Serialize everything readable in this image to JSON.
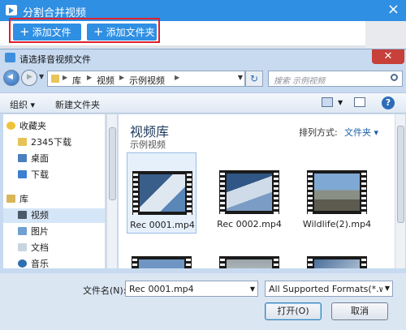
{
  "app": {
    "title": "分割合并视频",
    "close": "×",
    "add_file": "添加文件",
    "add_folder": "添加文件夹",
    "plus": "+"
  },
  "dialog": {
    "title": "请选择音视频文件",
    "close": "✕",
    "breadcrumbs": [
      "库",
      "视频",
      "示例视频"
    ],
    "search_placeholder": "搜索 示例视频",
    "organize": "组织 ▾",
    "new_folder": "新建文件夹",
    "help": "?",
    "nav": {
      "favorites": "收藏夹",
      "fav_items": [
        "2345下载",
        "桌面",
        "下载"
      ],
      "libraries": "库",
      "lib_items": [
        "视频",
        "图片",
        "文档",
        "音乐"
      ]
    },
    "library_title": "视频库",
    "library_subtitle": "示例视频",
    "arrange_label": "排列方式:",
    "arrange_value": "文件夹 ▾",
    "files": [
      "Rec 0001.mp4",
      "Rec 0002.mp4",
      "Wildlife(2).mp4"
    ],
    "filename_label": "文件名(N):",
    "filename_value": "Rec 0001.mp4",
    "filter_value": "All Supported Formats(*.wtv;",
    "open": "打开(O)",
    "cancel": "取消"
  },
  "colors": {
    "accent": "#2f8fe3",
    "highlight": "#e0202c",
    "dialog_frame": "#c7daf0"
  }
}
